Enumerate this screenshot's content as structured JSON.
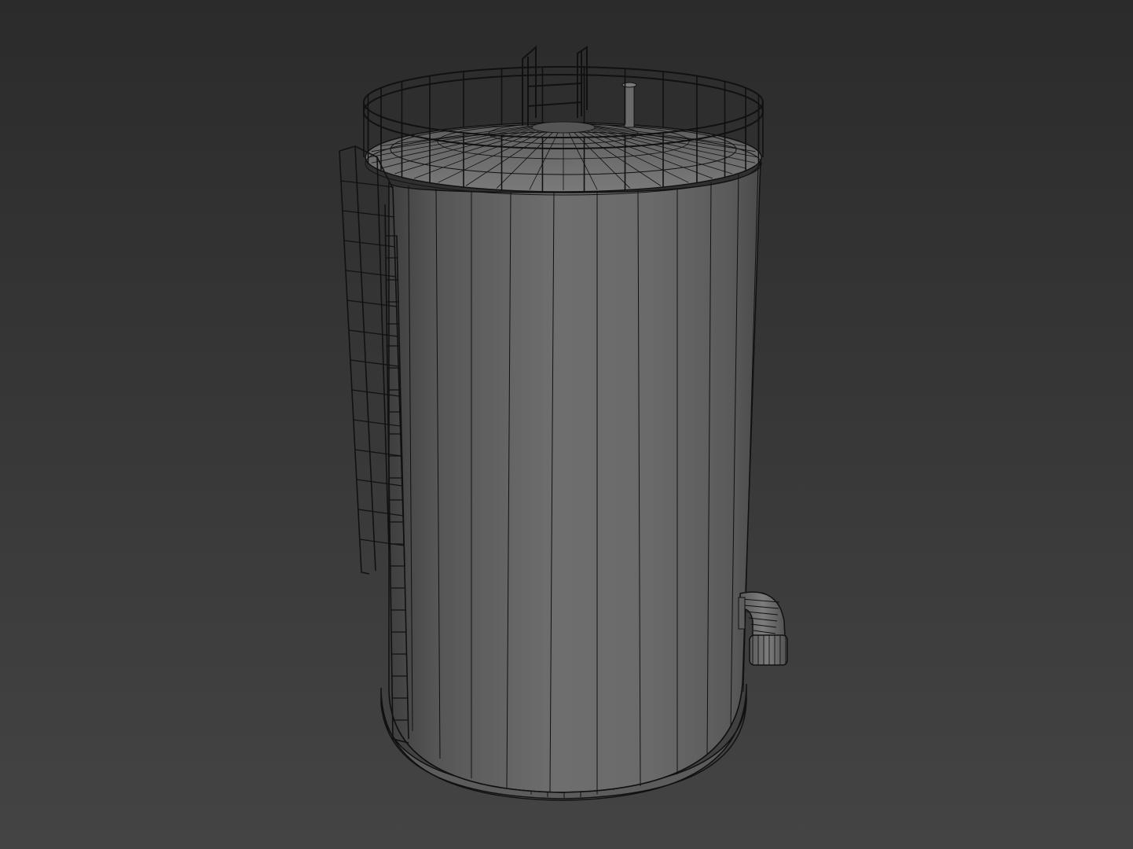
{
  "viewport": {
    "shading_mode": "shaded-wireframe",
    "background_top": "#2b2b2b",
    "background_bottom": "#444444"
  },
  "model": {
    "object": "storage-tank",
    "shell_color": "#6a6a6a",
    "wire_color": "#111111",
    "parts": [
      "tank-shell",
      "roof",
      "roof-guardrail",
      "roof-vent",
      "access-ladder",
      "base-ring",
      "outlet-pipe-elbow"
    ]
  }
}
